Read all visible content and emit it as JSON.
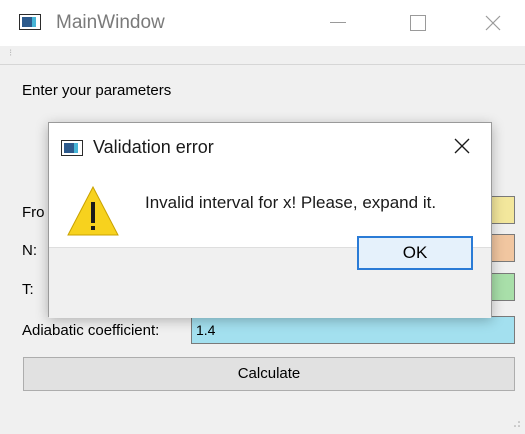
{
  "window": {
    "title": "MainWindow",
    "minimize_icon": "minimize-icon",
    "maximize_icon": "maximize-icon",
    "close_icon": "close-icon"
  },
  "form": {
    "heading": "Enter your parameters",
    "from_label": "Fro",
    "n_label": "N:",
    "t_label": "T:",
    "adiabatic_label": "Adiabatic coefficient:",
    "adiabatic_value": "1.4",
    "calculate_label": "Calculate",
    "field_colors": {
      "from": "#f3e79c",
      "n": "#f1c6a0",
      "t": "#a8dfa9",
      "adiabatic": "#a3e0ef"
    }
  },
  "dialog": {
    "title": "Validation error",
    "message": "Invalid interval for x! Please, expand it.",
    "ok_label": "OK",
    "icon": "warning-icon",
    "accent": "#2a7bd6"
  }
}
